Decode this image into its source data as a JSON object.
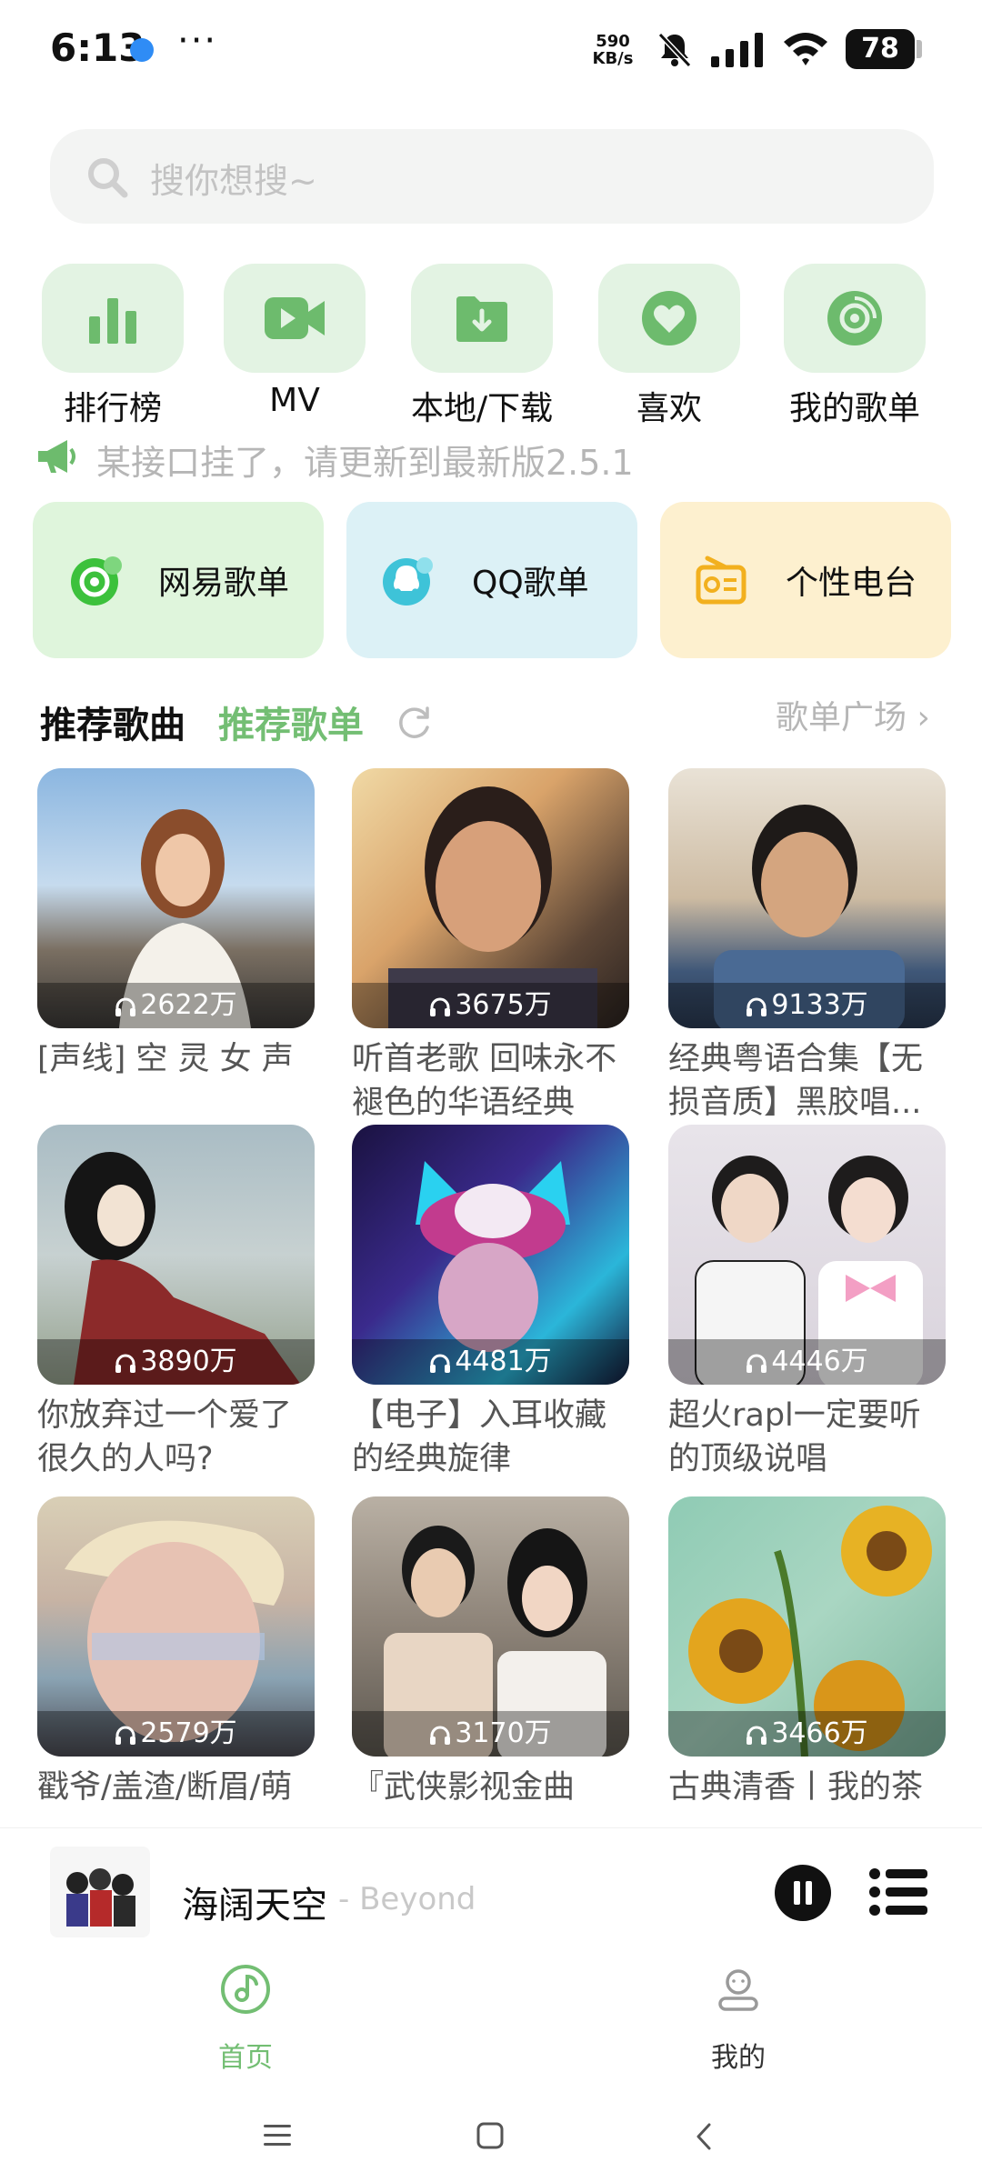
{
  "status_bar": {
    "time": "6:13",
    "more": "···",
    "speed_value": "590",
    "speed_unit": "KB/s",
    "battery": "78"
  },
  "search": {
    "placeholder": "搜你想搜~"
  },
  "quick_nav": [
    {
      "label": "排行榜",
      "icon": "bar-chart-icon"
    },
    {
      "label": "MV",
      "icon": "video-icon"
    },
    {
      "label": "本地/下载",
      "icon": "download-folder-icon"
    },
    {
      "label": "喜欢",
      "icon": "heart-icon"
    },
    {
      "label": "我的歌单",
      "icon": "disc-icon"
    }
  ],
  "notice": {
    "text": "某接口挂了，请更新到最新版2.5.1"
  },
  "source_cards": [
    {
      "label": "网易歌单",
      "bg": "#dff5dc",
      "icon": "netease-icon"
    },
    {
      "label": "QQ歌单",
      "bg": "#dcf1f6",
      "icon": "qq-icon"
    },
    {
      "label": "个性电台",
      "bg": "#fdf0cf",
      "icon": "radio-icon"
    }
  ],
  "section": {
    "tab_songs": "推荐歌曲",
    "tab_playlists": "推荐歌单",
    "square_link": "歌单广场 ›"
  },
  "playlists": [
    {
      "count": "2622万",
      "title": "[声线] 空 灵 女 声"
    },
    {
      "count": "3675万",
      "title": "听首老歌 回味永不褪色的华语经典"
    },
    {
      "count": "9133万",
      "title": "经典粤语合集【无损音质】黑胶唱..."
    },
    {
      "count": "3890万",
      "title": "你放弃过一个爱了很久的人吗?"
    },
    {
      "count": "4481万",
      "title": "【电子】入耳收藏的经典旋律"
    },
    {
      "count": "4446万",
      "title": "超火rapl一定要听的顶级说唱"
    },
    {
      "count": "2579万",
      "title": "戳爷/盖渣/断眉/萌"
    },
    {
      "count": "3170万",
      "title": "『武侠影视金曲"
    },
    {
      "count": "3466万",
      "title": "古典清香丨我的茶"
    }
  ],
  "player": {
    "title": "海阔天空",
    "artist": "- Beyond"
  },
  "bottom_tabs": [
    {
      "label": "首页",
      "active": true
    },
    {
      "label": "我的",
      "active": false
    }
  ],
  "colors": {
    "accent": "#73be73",
    "accent_light": "#e3f3e3",
    "muted": "#b6b6b6"
  }
}
